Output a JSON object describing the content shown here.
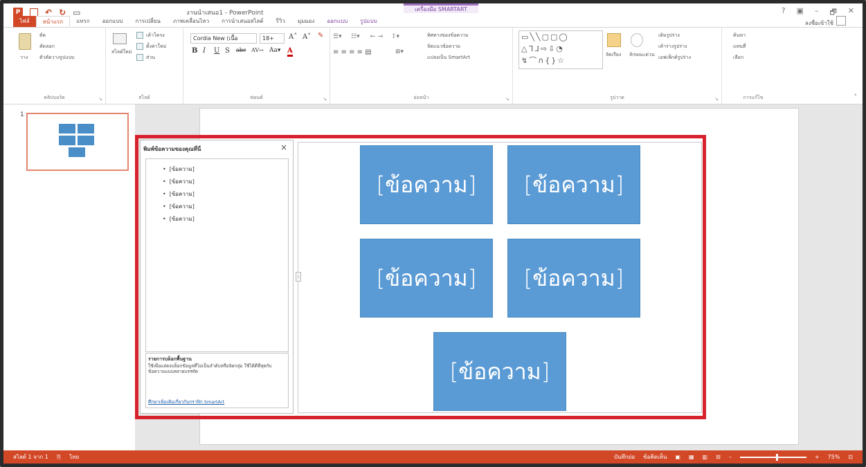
{
  "window": {
    "title": "งานนำเสนอ1 - PowerPoint",
    "contextual_tab_group": "เครื่องมือ SMARTART",
    "controls": [
      "?",
      "▣",
      "–",
      "🗗",
      "✕"
    ]
  },
  "tabs": [
    {
      "label": "ไฟล์",
      "kind": "file"
    },
    {
      "label": "หน้าแรก",
      "kind": "active"
    },
    {
      "label": "แทรก",
      "kind": "normal"
    },
    {
      "label": "ออกแบบ",
      "kind": "normal"
    },
    {
      "label": "การเปลี่ยน",
      "kind": "normal"
    },
    {
      "label": "ภาพเคลื่อนไหว",
      "kind": "normal"
    },
    {
      "label": "การนำเสนอสไลด์",
      "kind": "normal"
    },
    {
      "label": "รีวิว",
      "kind": "normal"
    },
    {
      "label": "มุมมอง",
      "kind": "normal"
    },
    {
      "label": "ออกแบบ",
      "kind": "ctx"
    },
    {
      "label": "รูปแบบ",
      "kind": "ctx"
    }
  ],
  "signin": "ลงชื่อเข้าใช้",
  "ribbon": {
    "clipboard": {
      "label": "คลิปบอร์ด",
      "paste": "วาง",
      "cut": "ตัด",
      "copy": "คัดลอก",
      "format_painter": "ตัวคัดวางรูปแบบ"
    },
    "slides": {
      "label": "สไลด์",
      "new_slide": "สไลด์ใหม่",
      "layout": "เค้าโครง",
      "reset": "ตั้งค่าใหม่",
      "section": "ส่วน"
    },
    "font": {
      "label": "ฟอนต์",
      "font_name": "Cordia New (เนื้อ",
      "font_size": "18+"
    },
    "paragraph": {
      "label": "ย่อหน้า",
      "text_direction": "ทิศทางของข้อความ",
      "align_text": "จัดแนวข้อความ",
      "convert_smartart": "แปลงเป็น SmartArt"
    },
    "drawing": {
      "label": "รูปวาด",
      "arrange": "จัดเรียง",
      "quick_styles": "ลักษณะด่วน",
      "shape_fill": "เติมรูปร่าง",
      "shape_outline": "เค้าร่างรูปร่าง",
      "shape_effects": "เอฟเฟ็กต์รูปร่าง"
    },
    "editing": {
      "label": "การแก้ไข",
      "find": "ค้นหา",
      "replace": "แทนที่",
      "select": "เลือก"
    }
  },
  "thumbnails": {
    "slide_number": "1"
  },
  "text_pane": {
    "header": "พิมพ์ข้อความของคุณที่นี่",
    "close": "×",
    "items": [
      "[ข้อความ]",
      "[ข้อความ]",
      "[ข้อความ]",
      "[ข้อความ]",
      "[ข้อความ]"
    ],
    "footer_title": "รายการบล็อกพื้นฐาน",
    "footer_desc": "ใช้เพื่อแสดงบล็อกข้อมูลที่ไม่เป็นลำดับหรือจัดกลุ่ม ใช้ได้ดีที่สุดกับข้อความแบบหลายบรรทัด",
    "footer_link": "ศึกษาเพิ่มเติมเกี่ยวกับกราฟิก SmartArt"
  },
  "smartart": {
    "boxes": [
      "[ข้อความ]",
      "[ข้อความ]",
      "[ข้อความ]",
      "[ข้อความ]",
      "[ข้อความ]"
    ],
    "fill_color": "#5b9bd5"
  },
  "status": {
    "slide_info": "สไลด์ 1 จาก 1",
    "language": "ไทย",
    "notes": "บันทึกย่อ",
    "comments": "ข้อคิดเห็น",
    "zoom": "75%"
  },
  "colors": {
    "accent": "#d24726",
    "highlight": "#d7222e"
  }
}
